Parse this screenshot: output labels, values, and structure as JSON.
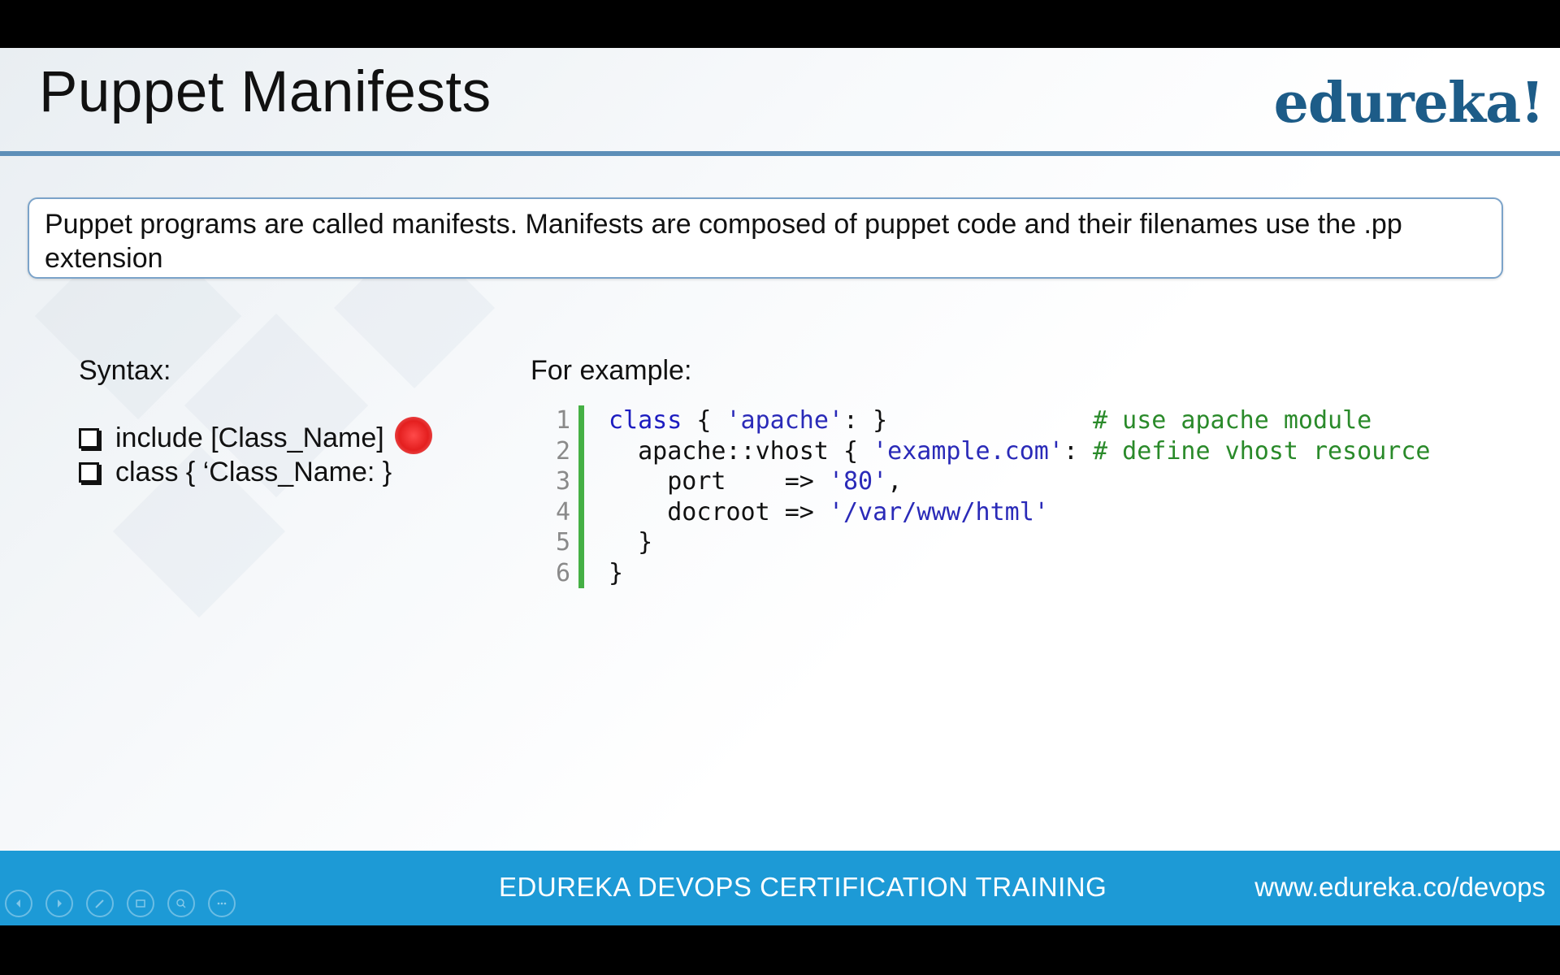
{
  "slide": {
    "title": "Puppet Manifests",
    "brand": "edureka!",
    "intro": "Puppet programs are called manifests. Manifests are composed of puppet code and their filenames use the .pp extension",
    "syntax_heading": "Syntax:",
    "syntax_items": [
      "include [Class_Name]",
      "class { ‘Class_Name: }"
    ],
    "example_heading": "For example:",
    "code_lines": [
      {
        "n": "1"
      },
      {
        "n": "2"
      },
      {
        "n": "3"
      },
      {
        "n": "4"
      },
      {
        "n": "5"
      },
      {
        "n": "6"
      }
    ],
    "code": {
      "l1_kw": "class",
      "l1_open": " { ",
      "l1_str": "'apache'",
      "l1_close": ": }",
      "l1_pad": "              ",
      "l1_comment": "# use apache module",
      "l2_indent": "  ",
      "l2_pl": "apache::vhost { ",
      "l2_str": "'example.com'",
      "l2_colon": ": ",
      "l2_comment": "# define vhost resource",
      "l3_indent": "    ",
      "l3_key": "port    => ",
      "l3_str": "'80'",
      "l3_end": ",",
      "l4_indent": "    ",
      "l4_key": "docroot => ",
      "l4_str": "'/var/www/html'",
      "l5": "  }",
      "l6": "}"
    },
    "footer_title": "EDUREKA DEVOPS CERTIFICATION TRAINING",
    "footer_url": "www.edureka.co/devops"
  },
  "nav_controls": [
    "previous-icon",
    "next-icon",
    "pen-icon",
    "slides-icon",
    "zoom-icon",
    "more-icon"
  ],
  "colors": {
    "brand": "#1d5c88",
    "footer": "#1d9ad6",
    "rule": "#5d8fb8",
    "code_bar": "#45b045",
    "pointer": "#e41f1f"
  }
}
